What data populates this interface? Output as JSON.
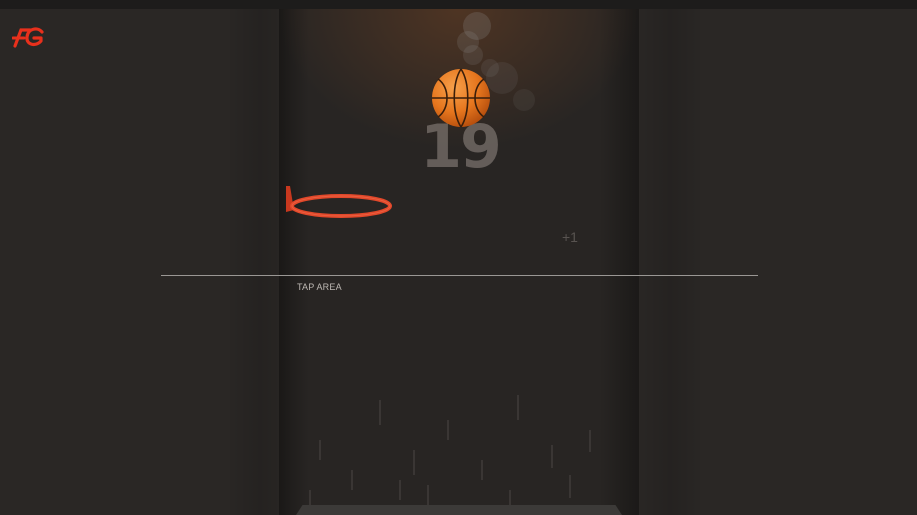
{
  "app": {
    "logo_icon": "fg-logo-icon",
    "logo_color": "#e8301c"
  },
  "game": {
    "score": "19",
    "tap_area_label": "TAP AREA",
    "bonus_text": "+1",
    "ball_color": "#e6761e",
    "hoop_color": "#e2482a"
  }
}
